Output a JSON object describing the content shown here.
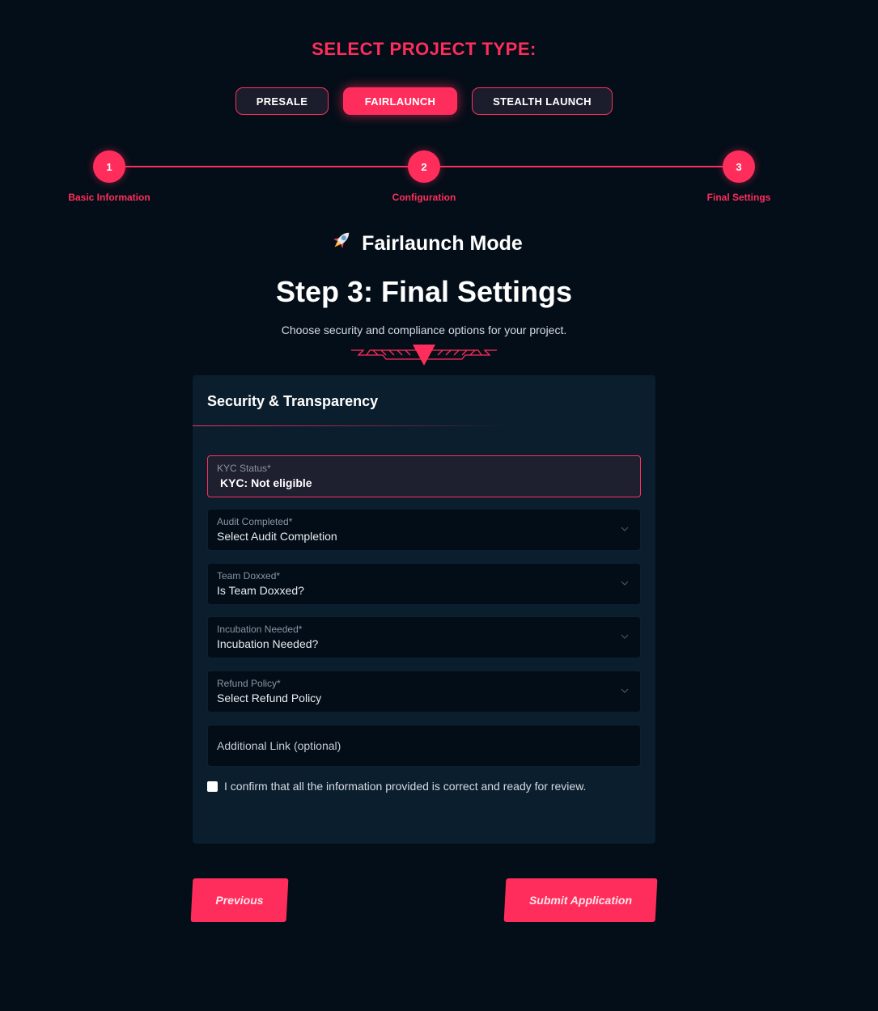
{
  "project_type": {
    "title": "SELECT PROJECT TYPE:",
    "options": [
      "PRESALE",
      "FAIRLAUNCH",
      "STEALTH LAUNCH"
    ],
    "selected": "FAIRLAUNCH"
  },
  "stepper": {
    "steps": [
      {
        "number": "1",
        "label": "Basic Information"
      },
      {
        "number": "2",
        "label": "Configuration"
      },
      {
        "number": "3",
        "label": "Final Settings"
      }
    ],
    "current": 3
  },
  "mode": {
    "icon": "rocket-icon",
    "title": "Fairlaunch Mode"
  },
  "step": {
    "title": "Step 3: Final Settings",
    "subtitle": "Choose security and compliance options for your project."
  },
  "panel": {
    "title": "Security & Transparency",
    "fields": {
      "kyc": {
        "label": "KYC Status*",
        "value": "KYC: Not eligible"
      },
      "audit": {
        "label": "Audit Completed*",
        "value": "Select Audit Completion"
      },
      "team": {
        "label": "Team Doxxed*",
        "value": "Is Team Doxxed?"
      },
      "incubation": {
        "label": "Incubation Needed*",
        "value": "Incubation Needed?"
      },
      "refund": {
        "label": "Refund Policy*",
        "value": "Select Refund Policy"
      },
      "link": {
        "placeholder": "Additional Link (optional)",
        "value": ""
      }
    },
    "confirm_text": "I confirm that all the information provided is correct and ready for review.",
    "confirm_checked": false
  },
  "nav": {
    "previous": "Previous",
    "submit": "Submit Application"
  },
  "colors": {
    "accent": "#ff2d5c",
    "background": "#040e18",
    "panel": "#0b1e2d"
  }
}
